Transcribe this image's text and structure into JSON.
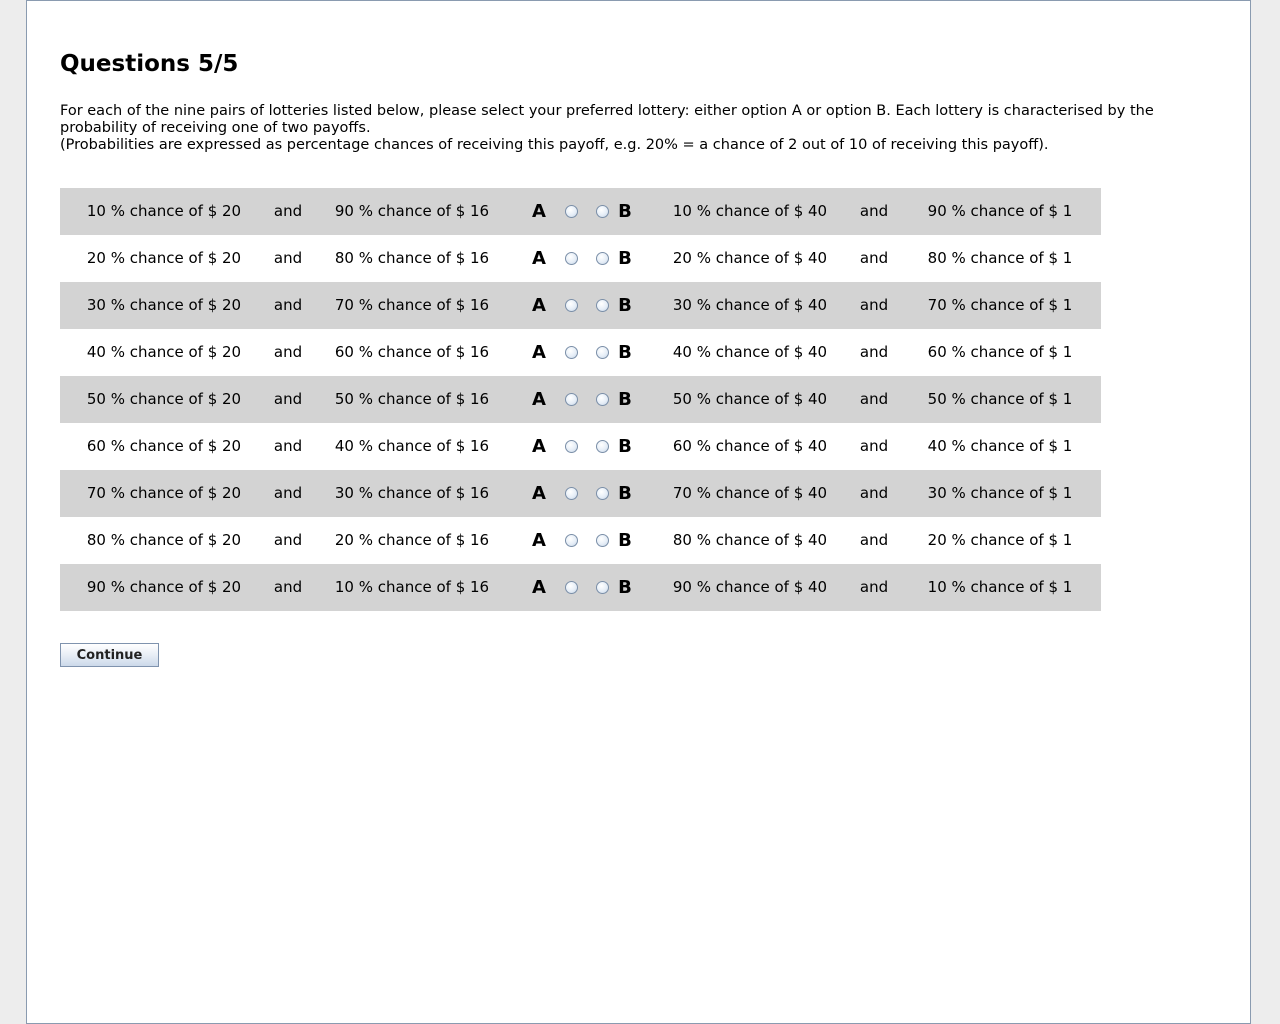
{
  "page": {
    "title": "Questions 5/5",
    "instructions_line1": "For each of the nine pairs of lotteries listed below, please select your preferred lottery: either option A or option B. Each lottery is characterised by the probability of receiving one of two payoffs.",
    "instructions_line2": "(Probabilities are expressed as percentage chances of receiving this payoff, e.g. 20% = a chance of 2 out of 10 of receiving this payoff)."
  },
  "labels": {
    "and": "and",
    "option_a": "A",
    "option_b": "B"
  },
  "rows": [
    {
      "a1": "10 % chance of $ 20",
      "a2": "90 % chance of $ 16",
      "b1": "10 % chance of $ 40",
      "b2": "90 % chance of $ 1",
      "selected": null
    },
    {
      "a1": "20 % chance of $ 20",
      "a2": "80 % chance of $ 16",
      "b1": "20 % chance of $ 40",
      "b2": "80 % chance of $ 1",
      "selected": null
    },
    {
      "a1": "30 % chance of $ 20",
      "a2": "70 % chance of $ 16",
      "b1": "30 % chance of $ 40",
      "b2": "70 % chance of $ 1",
      "selected": null
    },
    {
      "a1": "40 % chance of $ 20",
      "a2": "60 % chance of $ 16",
      "b1": "40 % chance of $ 40",
      "b2": "60 % chance of $ 1",
      "selected": null
    },
    {
      "a1": "50 % chance of $ 20",
      "a2": "50 % chance of $ 16",
      "b1": "50 % chance of $ 40",
      "b2": "50 % chance of $ 1",
      "selected": null
    },
    {
      "a1": "60 % chance of $ 20",
      "a2": "40 % chance of $ 16",
      "b1": "60 % chance of $ 40",
      "b2": "40 % chance of $ 1",
      "selected": null
    },
    {
      "a1": "70 % chance of $ 20",
      "a2": "30 % chance of $ 16",
      "b1": "70 % chance of $ 40",
      "b2": "30 % chance of $ 1",
      "selected": null
    },
    {
      "a1": "80 % chance of $ 20",
      "a2": "20 % chance of $ 16",
      "b1": "80 % chance of $ 40",
      "b2": "20 % chance of $ 1",
      "selected": null
    },
    {
      "a1": "90 % chance of $ 20",
      "a2": "10 % chance of $ 16",
      "b1": "90 % chance of $ 40",
      "b2": "10 % chance of $ 1",
      "selected": null
    }
  ],
  "buttons": {
    "continue_label": "Continue"
  },
  "colors": {
    "row_shade": "#d3d3d3",
    "panel_border": "#8a9bb0",
    "background": "#ededed"
  }
}
